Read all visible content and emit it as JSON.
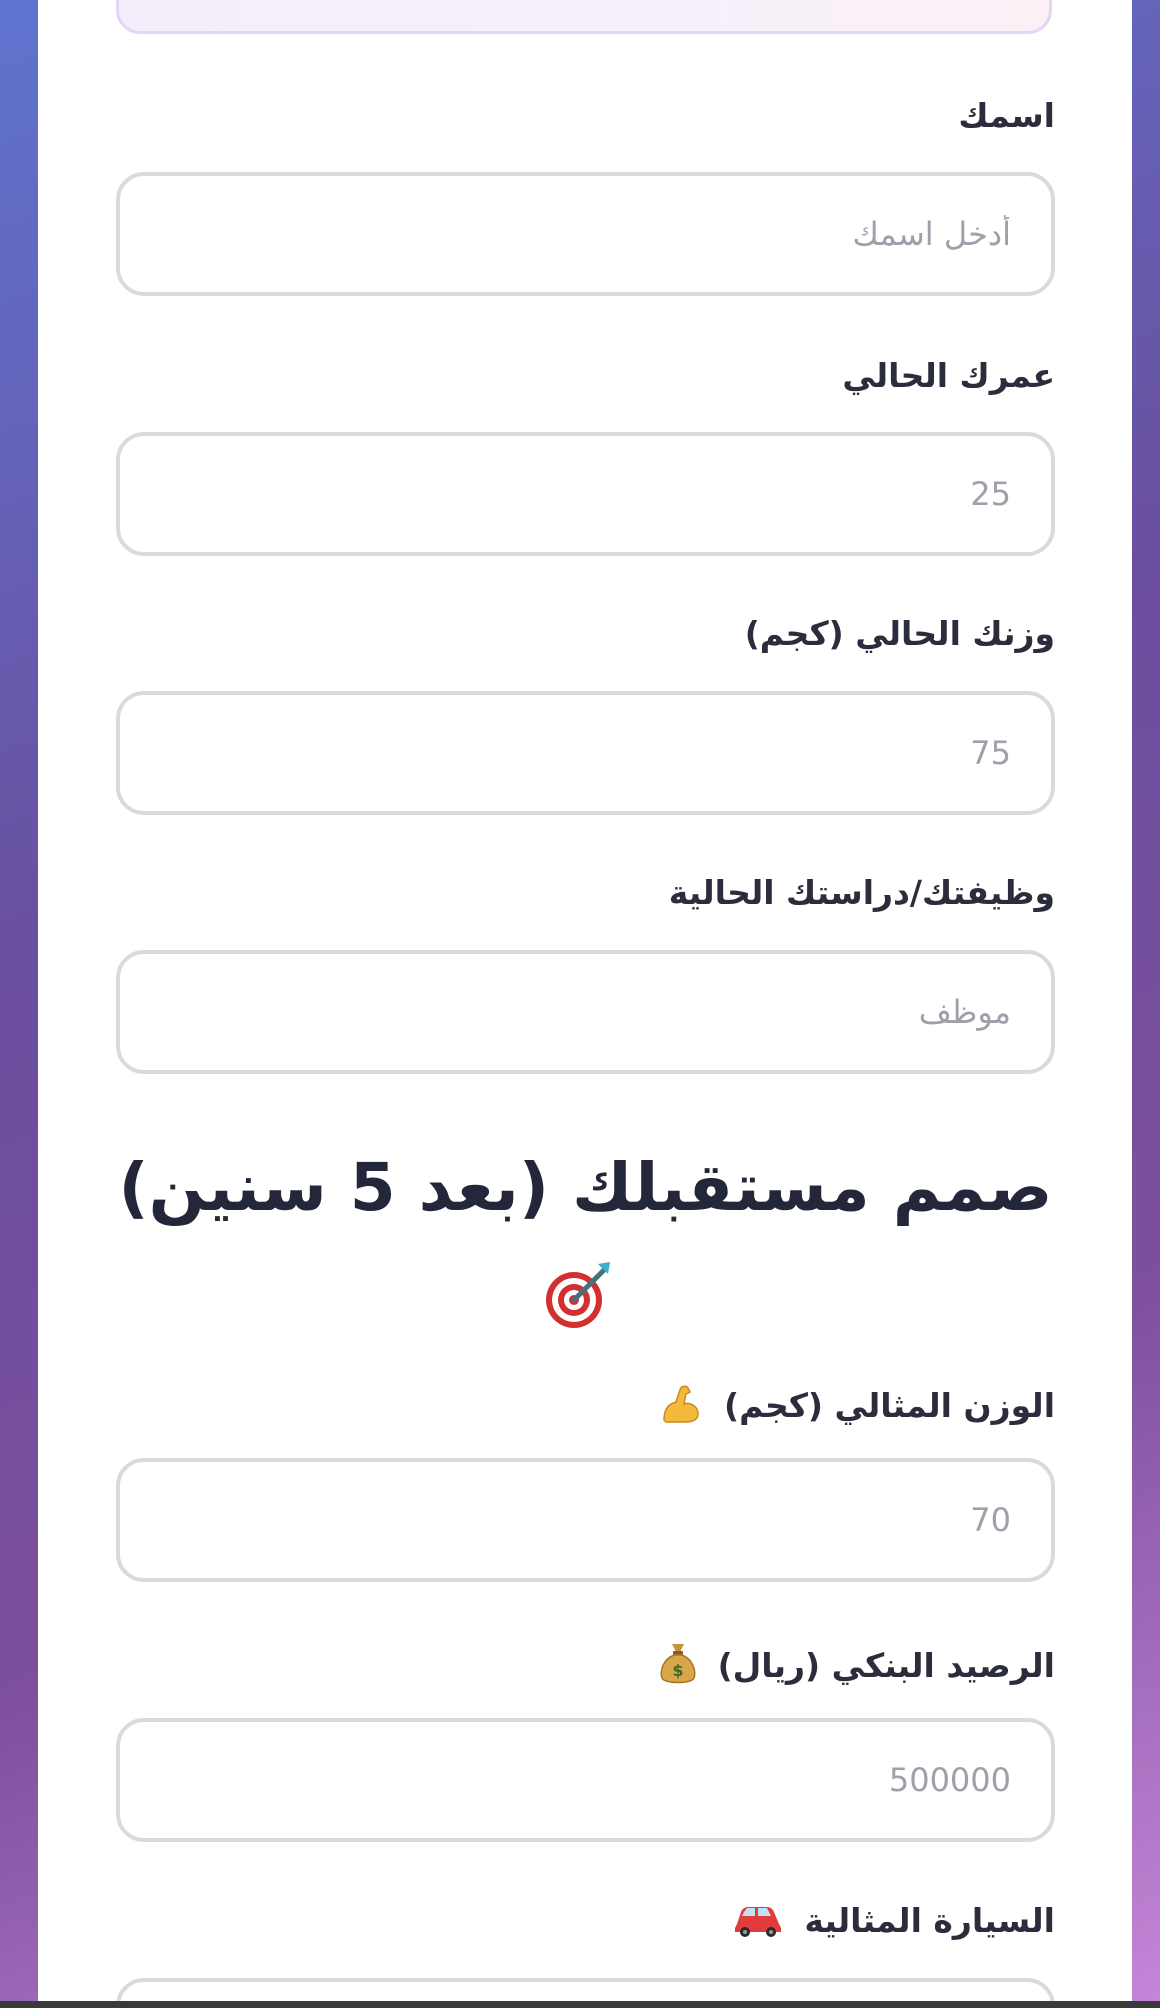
{
  "form": {
    "name": {
      "label": "اسمك",
      "placeholder": "أدخل اسمك"
    },
    "age": {
      "label": "عمرك الحالي",
      "placeholder": "25"
    },
    "weight": {
      "label": "وزنك الحالي (كجم)",
      "placeholder": "75"
    },
    "job": {
      "label": "وظيفتك/دراستك الحالية",
      "placeholder": "موظف"
    }
  },
  "future_section": {
    "title": "صمم مستقبلك (بعد 5 سنين)",
    "title_icon": "target-icon",
    "ideal_weight": {
      "label": "الوزن المثالي (كجم)",
      "icon": "flexed-biceps-icon",
      "placeholder": "70"
    },
    "bank_balance": {
      "label": "الرصيد البنكي (ريال)",
      "icon": "money-bag-icon",
      "placeholder": "500000"
    },
    "ideal_car": {
      "label": "السيارة المثالية",
      "icon": "car-icon"
    }
  },
  "colors": {
    "input_border": "#d9d9de",
    "label_text": "#2b2d3d",
    "placeholder_text": "#a0a0aa",
    "top_box_border": "#e4d6f6"
  }
}
